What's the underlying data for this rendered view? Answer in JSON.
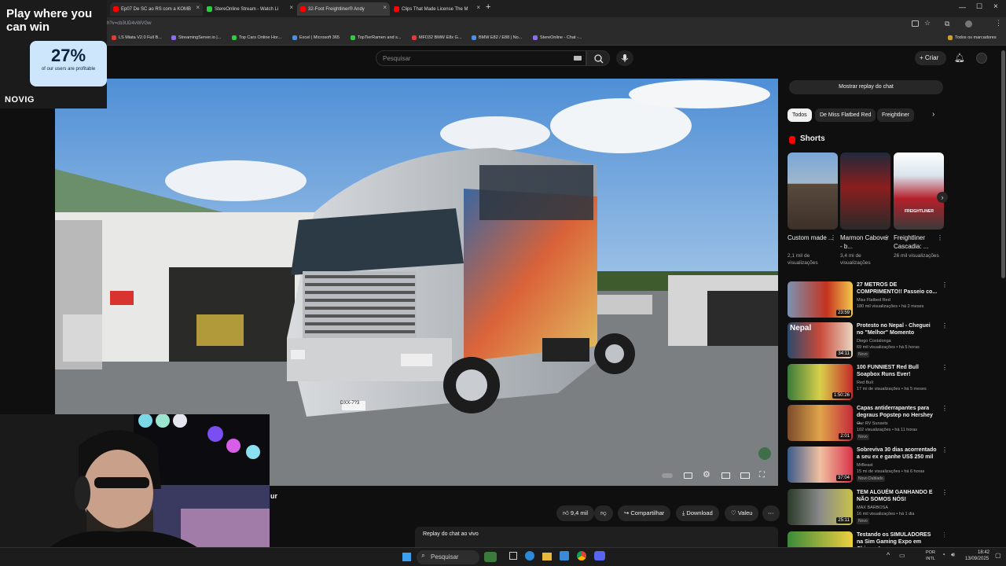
{
  "browser": {
    "tabs": [
      {
        "label": "Ep07 De SC ao RS com a KOMB",
        "favicon_color": "#ff0000"
      },
      {
        "label": "StereOnline Stream - Watch Li",
        "favicon_color": "#2ecc40"
      },
      {
        "label": "32-Foot Freightliner® Andy",
        "favicon_color": "#ff0000"
      },
      {
        "label": "Clips That Made License The M",
        "favicon_color": "#ff0000"
      }
    ],
    "url": "h?v=cb3UD4vWVGw",
    "bookmarks": [
      {
        "label": "LS Miata V2.0 Full B...",
        "color": "#e53935"
      },
      {
        "label": "StreamingServer.io |...",
        "color": "#8e6cf0"
      },
      {
        "label": "Top Cars Online Hor...",
        "color": "#2ecc40"
      },
      {
        "label": "Excel | Microsoft 365",
        "color": "#4a90e2"
      },
      {
        "label": "TopTierRamen and s...",
        "color": "#2ecc40"
      },
      {
        "label": "MFD32 BMW E8x G...",
        "color": "#e53935"
      },
      {
        "label": "BMW E82 / E88 | No...",
        "color": "#4a90e2"
      },
      {
        "label": "StereOnline - Chat -...",
        "color": "#8e6cf0"
      }
    ],
    "all_bookmarks": "Todos os marcadores"
  },
  "ad": {
    "headline": "Play where you can win",
    "percent": "27%",
    "subtext": "of our users are profitable",
    "brand": "NOVIG"
  },
  "header": {
    "search_placeholder": "Pesquisar",
    "create_label": "Criar"
  },
  "video": {
    "plate": "DXX-7?3",
    "title_fragment": "ur"
  },
  "actions": {
    "likes": "9,4 mil",
    "share": "Compartilhar",
    "download": "Download",
    "thanks": "Valeu"
  },
  "chat": {
    "replay_button": "Mostrar replay do chat",
    "replay_title": "Replay do chat ao vivo"
  },
  "chips": [
    {
      "label": "Todos",
      "active": true
    },
    {
      "label": "De Miss Flatbed Red",
      "active": false
    },
    {
      "label": "Freightliner",
      "active": false
    }
  ],
  "shorts": {
    "title": "Shorts",
    "items": [
      {
        "title": "Custom made ...",
        "views": "2,1 mil de visualizações"
      },
      {
        "title": "Marmon Cabover - b...",
        "views": "3,4 mi de visualizações"
      },
      {
        "title": "Freightliner Cascadia: ...",
        "views": "26 mil visualizações",
        "overlay": "FREIGHTLINER"
      }
    ]
  },
  "recommendations": [
    {
      "title": "27 METROS DE COMPRIMENTO!! Passeio co...",
      "channel": "Miss Flatbed Red",
      "meta": "180 mil visualizações • há 2 meses",
      "badge": "",
      "duration": "23:59"
    },
    {
      "title": "Protesto no Nepal - Cheguei no \"Melhor\" Momento",
      "channel": "Diego Costalonga",
      "meta": "69 mil visualizações • há 5 horas",
      "badge": "Novo",
      "duration": "34:11",
      "thumb_text": "Nepal"
    },
    {
      "title": "100 FUNNIEST Red Bull Soapbox Runs Ever!",
      "channel": "Red Bull",
      "meta": "17 mi de visualizações • há 5 meses",
      "badge": "",
      "duration": "1:50:26"
    },
    {
      "title": "Capas antiderrapantes para degraus Popstep no Hershey ...",
      "channel": "Our RV Sunsets",
      "meta": "102 visualizações • há 11 horas",
      "badge": "Novo",
      "duration": "2:01"
    },
    {
      "title": "Sobreviva 30 dias acorrentado a seu ex e ganhe US$ 250 mil",
      "channel": "MrBeast",
      "meta": "15 mi de visualizações • há 6 horas",
      "badge": "Novo  Dublado",
      "duration": "37:04"
    },
    {
      "title": "TEM ALGUÉM GANHANDO E NÃO SOMOS NÓS!",
      "channel": "MAX BARBOSA",
      "meta": "16 mil visualizações • há 1 dia",
      "badge": "Novo",
      "duration": "25:11"
    },
    {
      "title": "Testando os SIMULADORES na Sim Gaming Expo em Chicago!",
      "channel": "",
      "meta": "",
      "badge": "",
      "duration": ""
    }
  ],
  "taskbar": {
    "search": "Pesquisar",
    "lang_top": "POR",
    "lang_bottom": "INTL",
    "time": "18:42",
    "date": "13/09/2025"
  },
  "colors": {
    "background": "#0f0f0f",
    "youtube_red": "#ff0000",
    "ad_box": "#cde6fb"
  }
}
